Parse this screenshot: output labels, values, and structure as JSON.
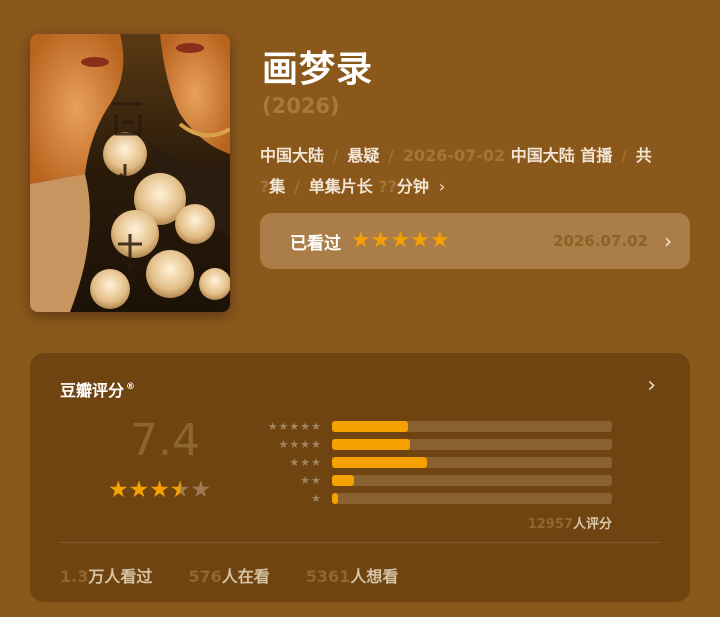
{
  "title": "画梦录",
  "year": "(2026)",
  "meta": {
    "region": "中国大陆",
    "genre": "悬疑",
    "premiere_date": "2026-07-02",
    "premiere_region": "中国大陆",
    "premiere_suffix": "首播",
    "episodes_prefix": "共",
    "episodes_count": "?",
    "episodes_suffix": "集",
    "runtime_label": "单集片长",
    "runtime_value": "??",
    "runtime_unit": "分钟"
  },
  "watched": {
    "label": "已看过",
    "stars": 5,
    "date": "2026.07.02"
  },
  "rating_card": {
    "title": "豆瓣评分",
    "registered_mark": "®",
    "score": "7.4",
    "score_stars": 3.5,
    "distribution": [
      {
        "stars": "★★★★★",
        "percent": 27
      },
      {
        "stars": "★★★★",
        "percent": 28
      },
      {
        "stars": "★★★",
        "percent": 34
      },
      {
        "stars": "★★",
        "percent": 8
      },
      {
        "stars": "★",
        "percent": 2
      }
    ],
    "votes_count": "12957",
    "votes_label": "人评分"
  },
  "stats": {
    "watched_num": "1.3",
    "watched_label": "万人看过",
    "watching_num": "576",
    "watching_label": "人在看",
    "wish_num": "5361",
    "wish_label": "人想看"
  },
  "colors": {
    "background": "#8b581c",
    "card": "#6f4410",
    "accent_star": "#f5a100"
  }
}
